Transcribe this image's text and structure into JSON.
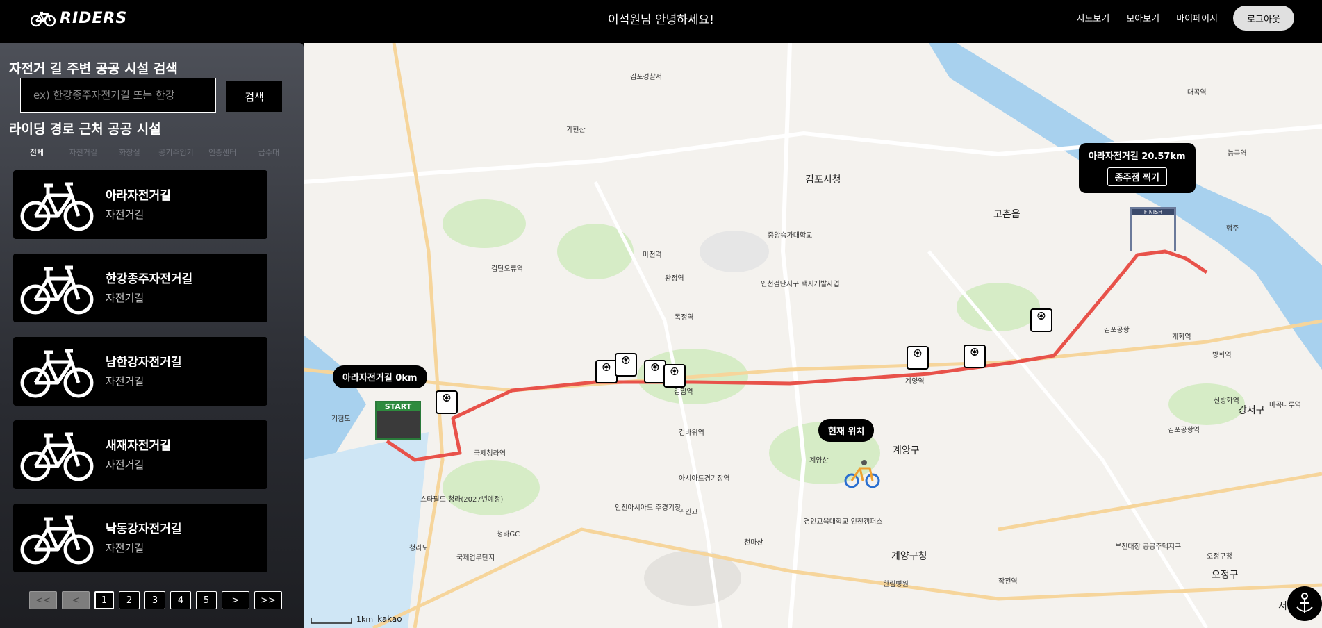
{
  "header": {
    "logo_text": "RIDERS",
    "greeting": "이석원님 안녕하세요!",
    "nav": [
      "지도보기",
      "모아보기",
      "마이페이지"
    ],
    "logout_label": "로그아웃"
  },
  "sidebar": {
    "title": "자전거 길 주변 공공 시설 검색",
    "search_placeholder": "ex) 한강종주자전거길 또는 한강",
    "search_label": "검색",
    "subtitle": "라이딩 경로 근처 공공 시설",
    "categories": [
      "전체",
      "자전거길",
      "화장실",
      "공기주입기",
      "인증센터",
      "급수대"
    ],
    "items": [
      {
        "name": "아라자전거길",
        "type": "자전거길"
      },
      {
        "name": "한강종주자전거길",
        "type": "자전거길"
      },
      {
        "name": "남한강자전거길",
        "type": "자전거길"
      },
      {
        "name": "새재자전거길",
        "type": "자전거길"
      },
      {
        "name": "낙동강자전거길",
        "type": "자전거길"
      }
    ],
    "pager": [
      "<<",
      "<",
      "1",
      "2",
      "3",
      "4",
      "5",
      ">",
      ">>"
    ]
  },
  "map": {
    "start_callout": "아라자전거길   0km",
    "finish_callout": "아라자전거길  20.57km",
    "finish_button": "종주점 찍기",
    "current_location": "현재 위치",
    "start_sign": "START",
    "finish_sign": "FINISH",
    "labels": [
      "김포시청",
      "고촌읍",
      "계양구",
      "계양구청",
      "오정구",
      "서구청",
      "검암역",
      "계양역",
      "김포공항역",
      "강서구",
      "중앙승가대학교",
      "김포경찰서",
      "거첨도",
      "청라도",
      "가현산",
      "천마산",
      "계양산",
      "검단오류역",
      "마전역",
      "완정역",
      "독정역",
      "검바위역",
      "아시아드경기장역",
      "귀인교",
      "경인교육대학교 인천캠퍼스",
      "한림병원",
      "부천대장 공공주택지구",
      "오정구청",
      "작전역",
      "인천검단지구 택지개발사업",
      "김포공항",
      "대곡역",
      "능곡역",
      "행주",
      "개화역",
      "방화역",
      "신방화역",
      "마곡나루역",
      "국제청라역",
      "청라GC",
      "인천아시아드 주경기장",
      "스타필드 청라(2027년예정)",
      "국제업무단지"
    ],
    "scale_label": "1km",
    "brand": "kakao"
  },
  "colors": {
    "route": "#e8524a",
    "water": "#a8d1ee",
    "accent": "#000000"
  }
}
